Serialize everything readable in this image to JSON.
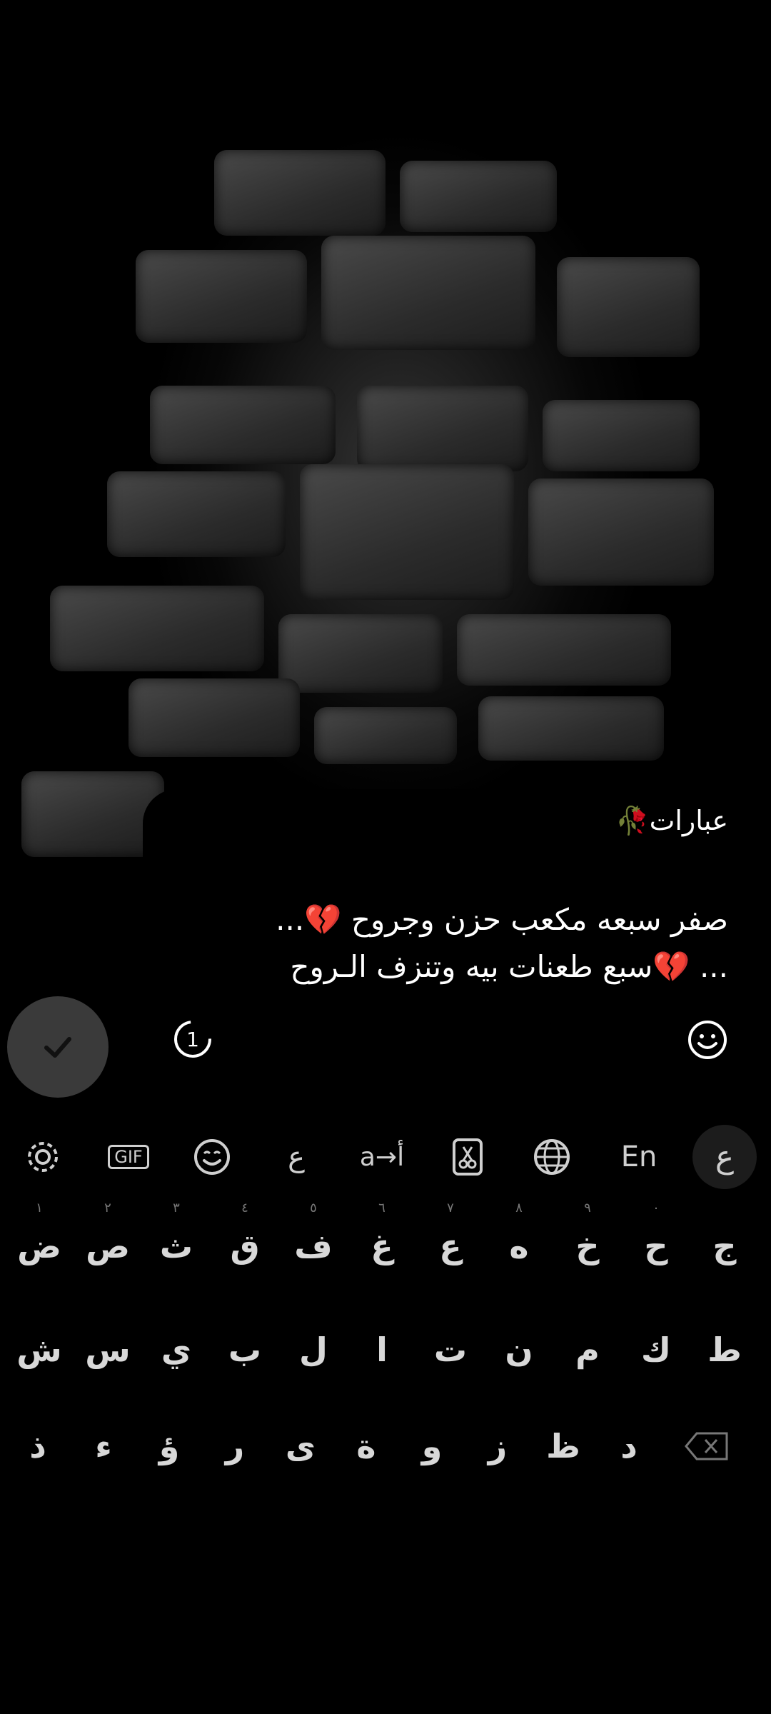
{
  "bubble": {
    "title": "عبارات🥀",
    "body_line1": "صفر سبعه مكعب حزن وجروح 💔...",
    "body_line2": "... 💔سبع طعنات بيه وتنزف الـروح",
    "counter_icon": "timer-1-icon",
    "emoji_icon": "smiley-icon"
  },
  "confirm_icon": "checkmark-icon",
  "toolbar": {
    "settings_icon": "gear-icon",
    "gif_label": "GIF",
    "emoji_icon": "smiley-icon",
    "arabic_kashida_label": "ﻉ",
    "translate_label": "a→أ",
    "clipboard_icon": "scissors-clipboard-icon",
    "globe_icon": "globe-icon",
    "lang_label": "En",
    "arabic_label": "ع"
  },
  "keys": {
    "row1": [
      "ض",
      "ص",
      "ث",
      "ق",
      "ف",
      "غ",
      "ع",
      "ه",
      "خ",
      "ح",
      "ج"
    ],
    "row1_hints": [
      "١",
      "٢",
      "٣",
      "٤",
      "٥",
      "٦",
      "٧",
      "٨",
      "٩",
      "٠",
      ""
    ],
    "row2": [
      "ش",
      "س",
      "ي",
      "ب",
      "ل",
      "ا",
      "ت",
      "ن",
      "م",
      "ك",
      "ط"
    ],
    "row3": [
      "ذ",
      "ء",
      "ؤ",
      "ر",
      "ى",
      "ة",
      "و",
      "ز",
      "ظ",
      "د"
    ],
    "backspace_icon": "backspace-icon"
  }
}
